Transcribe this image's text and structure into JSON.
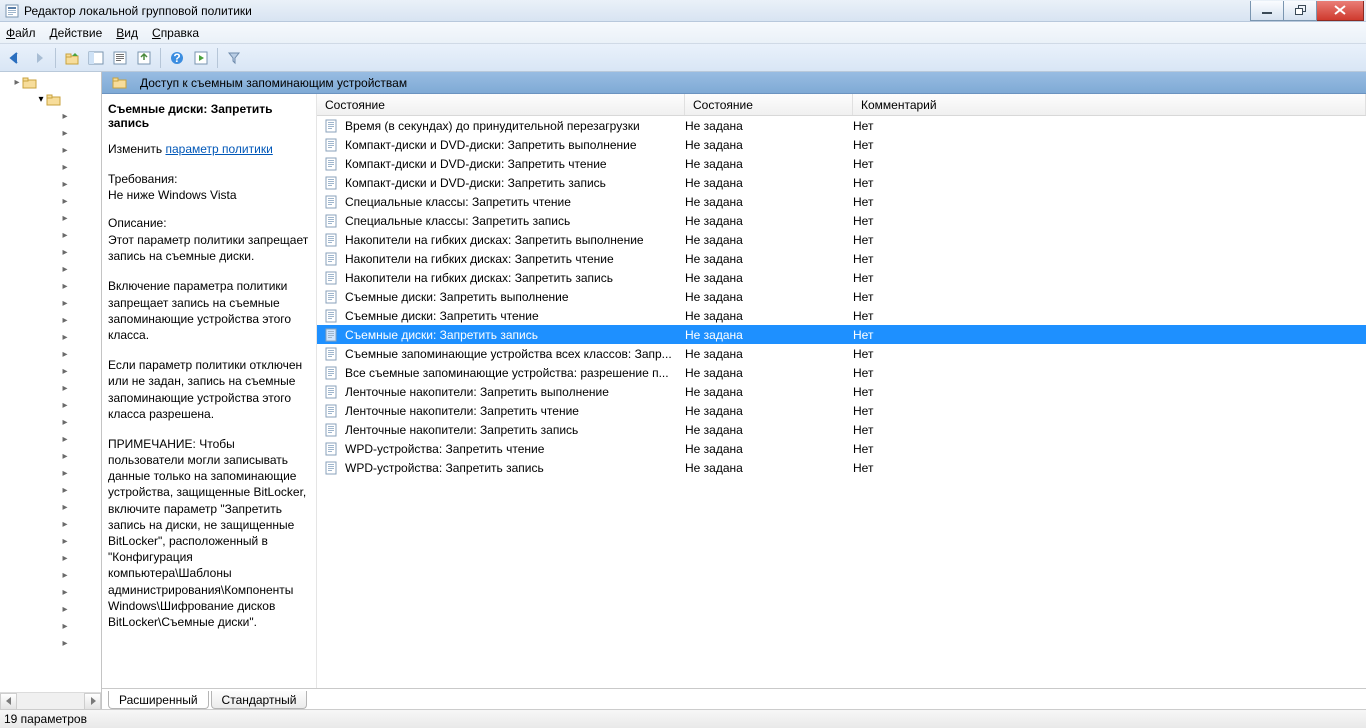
{
  "window": {
    "title": "Редактор локальной групповой политики"
  },
  "menu": {
    "file": "Файл",
    "action": "Действие",
    "view": "Вид",
    "help": "Справка"
  },
  "pathbar": {
    "title": "Доступ к съемным запоминающим устройствам"
  },
  "details": {
    "title": "Съемные диски: Запретить запись",
    "edit_prefix": "Изменить ",
    "edit_link": "параметр политики",
    "req_label": "Требования:",
    "req_value": "Не ниже Windows Vista",
    "desc_label": "Описание:",
    "desc1": "Этот параметр политики запрещает запись на съемные диски.",
    "desc2": "Включение параметра политики запрещает запись на съемные запоминающие устройства этого класса.",
    "desc3": "Если параметр политики отключен или не задан, запись на съемные запоминающие устройства этого класса разрешена.",
    "desc4": "ПРИМЕЧАНИЕ: Чтобы пользователи могли записывать данные только на запоминающие устройства, защищенные BitLocker, включите параметр \"Запретить запись на диски, не защищенные BitLocker\", расположенный в \"Конфигурация компьютера\\Шаблоны администрирования\\Компоненты Windows\\Шифрование дисков BitLocker\\Съемные диски\"."
  },
  "columns": {
    "c1": "Состояние",
    "c2": "Состояние",
    "c3": "Комментарий"
  },
  "rows": [
    {
      "t": "Время (в секундах) до принудительной перезагрузки",
      "s": "Не задана",
      "c": "Нет"
    },
    {
      "t": "Компакт-диски и DVD-диски: Запретить выполнение",
      "s": "Не задана",
      "c": "Нет"
    },
    {
      "t": "Компакт-диски и DVD-диски: Запретить чтение",
      "s": "Не задана",
      "c": "Нет"
    },
    {
      "t": "Компакт-диски и DVD-диски: Запретить запись",
      "s": "Не задана",
      "c": "Нет"
    },
    {
      "t": "Специальные классы: Запретить чтение",
      "s": "Не задана",
      "c": "Нет"
    },
    {
      "t": "Специальные классы: Запретить запись",
      "s": "Не задана",
      "c": "Нет"
    },
    {
      "t": "Накопители на гибких дисках: Запретить выполнение",
      "s": "Не задана",
      "c": "Нет"
    },
    {
      "t": "Накопители на гибких дисках: Запретить чтение",
      "s": "Не задана",
      "c": "Нет"
    },
    {
      "t": "Накопители на гибких дисках: Запретить запись",
      "s": "Не задана",
      "c": "Нет"
    },
    {
      "t": "Съемные диски: Запретить выполнение",
      "s": "Не задана",
      "c": "Нет"
    },
    {
      "t": "Съемные диски: Запретить чтение",
      "s": "Не задана",
      "c": "Нет"
    },
    {
      "t": "Съемные диски: Запретить запись",
      "s": "Не задана",
      "c": "Нет",
      "sel": true
    },
    {
      "t": "Съемные запоминающие устройства всех классов: Запр...",
      "s": "Не задана",
      "c": "Нет"
    },
    {
      "t": "Все съемные запоминающие устройства: разрешение п...",
      "s": "Не задана",
      "c": "Нет"
    },
    {
      "t": "Ленточные накопители: Запретить выполнение",
      "s": "Не задана",
      "c": "Нет"
    },
    {
      "t": "Ленточные накопители: Запретить чтение",
      "s": "Не задана",
      "c": "Нет"
    },
    {
      "t": "Ленточные накопители: Запретить запись",
      "s": "Не задана",
      "c": "Нет"
    },
    {
      "t": "WPD-устройства: Запретить чтение",
      "s": "Не задана",
      "c": "Нет"
    },
    {
      "t": "WPD-устройства: Запретить запись",
      "s": "Не задана",
      "c": "Нет"
    }
  ],
  "tabs": {
    "extended": "Расширенный",
    "standard": "Стандартный"
  },
  "status": {
    "text": "19 параметров"
  }
}
